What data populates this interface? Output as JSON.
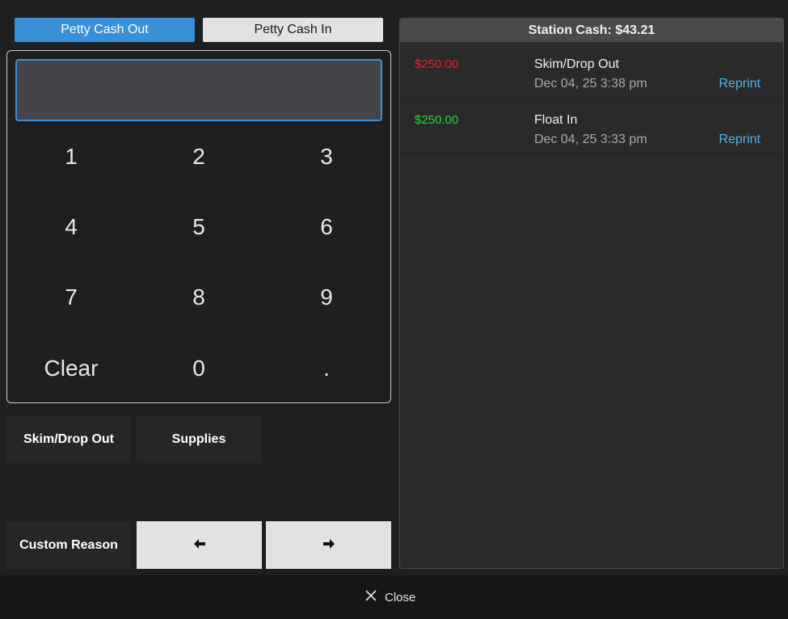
{
  "tabs": {
    "petty_cash_out": "Petty Cash Out",
    "petty_cash_in": "Petty Cash In"
  },
  "amount_input": {
    "value": "",
    "placeholder": ""
  },
  "keypad": {
    "k1": "1",
    "k2": "2",
    "k3": "3",
    "k4": "4",
    "k5": "5",
    "k6": "6",
    "k7": "7",
    "k8": "8",
    "k9": "9",
    "clear": "Clear",
    "k0": "0",
    "dot": "."
  },
  "reasons": {
    "skim_drop_out": "Skim/Drop Out",
    "supplies": "Supplies",
    "custom_reason": "Custom Reason"
  },
  "panel": {
    "header": "Station Cash: $43.21",
    "transactions": [
      {
        "amount": "$250.00",
        "type": "out",
        "reason": "Skim/Drop Out",
        "date": "Dec 04, 25 3:38 pm",
        "action": "Reprint"
      },
      {
        "amount": "$250.00",
        "type": "in",
        "reason": "Float In",
        "date": "Dec 04, 25 3:33 pm",
        "action": "Reprint"
      }
    ]
  },
  "footer": {
    "close_label": "Close"
  },
  "colors": {
    "accent": "#3a8fd9",
    "amount_out": "#e8202a",
    "amount_in": "#22d83a",
    "link": "#4fb4e8"
  },
  "icons": {
    "prev": "arrow-left-icon",
    "next": "arrow-right-icon",
    "close": "close-icon"
  }
}
